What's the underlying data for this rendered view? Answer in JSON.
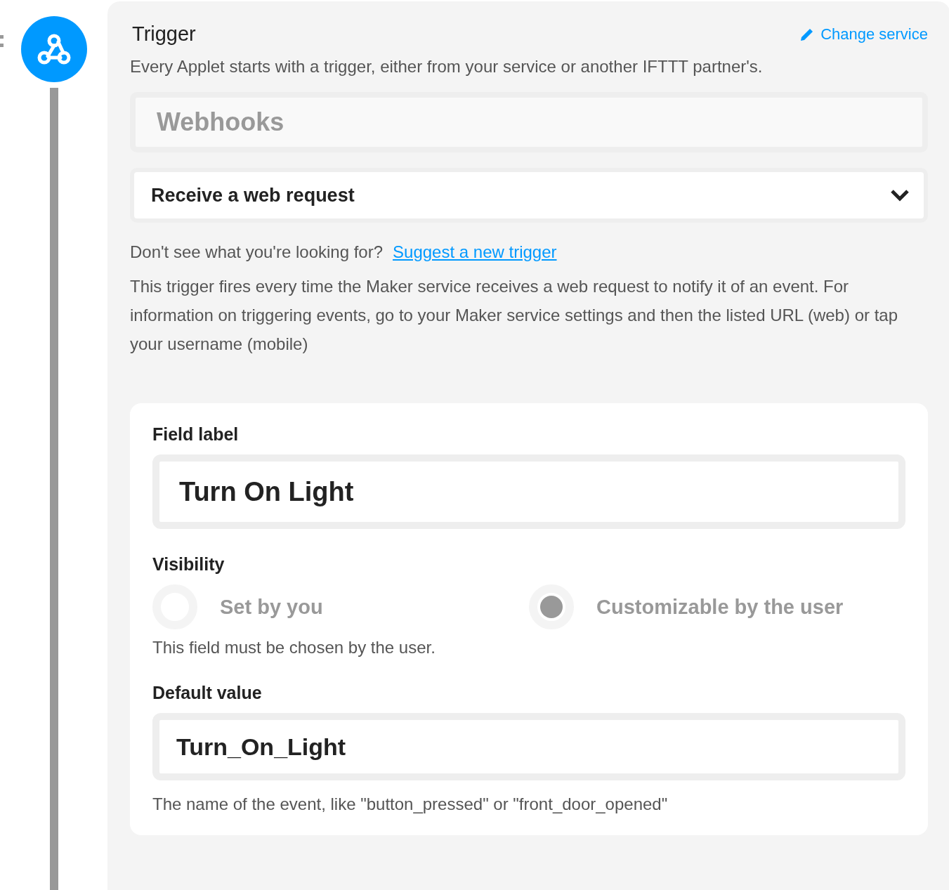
{
  "trigger": {
    "title": "Trigger",
    "change_link": "Change service",
    "description": "Every Applet starts with a trigger, either from your service or another IFTTT partner's.",
    "service": {
      "placeholder": "Webhooks"
    },
    "trigger_select": {
      "value": "Receive a web request"
    },
    "suggest": {
      "question": "Don't see what you're looking for?",
      "link": "Suggest a new trigger"
    },
    "help": "This trigger fires every time the Maker service receives a web request to notify it of an event. For information on triggering events, go to your Maker service settings and then the listed URL (web) or tap your username (mobile)"
  },
  "field_card": {
    "field_label": {
      "label": "Field label",
      "value": "Turn On Light"
    },
    "visibility": {
      "label": "Visibility",
      "options": [
        {
          "label": "Set by you",
          "selected": false
        },
        {
          "label": "Customizable by the user",
          "selected": true
        }
      ],
      "note": "This field must be chosen by the user."
    },
    "default_value": {
      "label": "Default value",
      "value": "Turn_On_Light",
      "hint": "The name of the event, like \"button_pressed\" or \"front_door_opened\""
    }
  }
}
